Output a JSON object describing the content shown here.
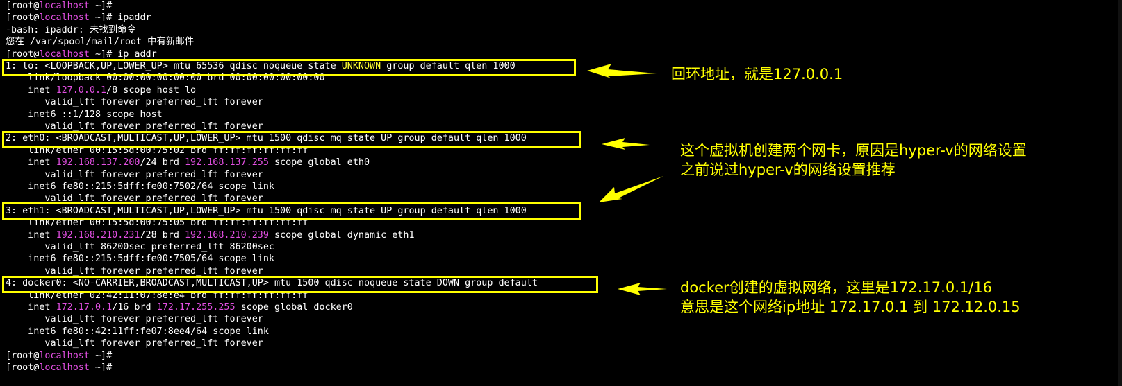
{
  "window": {
    "title": ""
  },
  "terminal": {
    "lines": [
      [
        {
          "t": "[root@"
        },
        {
          "t": "localhost",
          "c": "host"
        },
        {
          "t": " ~]#"
        }
      ],
      [
        {
          "t": "[root@"
        },
        {
          "t": "localhost",
          "c": "host"
        },
        {
          "t": " ~]# ipaddr"
        }
      ],
      [
        {
          "t": "-bash: ipaddr: 未找到命令"
        }
      ],
      [
        {
          "t": "您在 /var/spool/mail/root 中有新邮件"
        }
      ],
      [
        {
          "t": "[root@"
        },
        {
          "t": "localhost",
          "c": "host"
        },
        {
          "t": " ~]# ip addr"
        }
      ],
      [
        {
          "t": "1: lo: <LOOPBACK,UP,LOWER_UP> mtu 65536 qdisc noqueue state "
        },
        {
          "t": "UNKNOWN",
          "c": "state"
        },
        {
          "t": " group default qlen 1000"
        }
      ],
      [
        {
          "t": "    link/loopback 00:00:00:00:00:00 brd 00:00:00:00:00:00"
        }
      ],
      [
        {
          "t": "    inet "
        },
        {
          "t": "127.0.0.1",
          "c": "ip"
        },
        {
          "t": "/8 scope host lo"
        }
      ],
      [
        {
          "t": "       valid_lft forever preferred_lft forever"
        }
      ],
      [
        {
          "t": "    inet6 ::1/128 scope host"
        }
      ],
      [
        {
          "t": "       valid_lft forever preferred_lft forever"
        }
      ],
      [
        {
          "t": "2: eth0: <BROADCAST,MULTICAST,UP,LOWER_UP> mtu 1500 qdisc mq state UP group default qlen 1000"
        }
      ],
      [
        {
          "t": "    link/ether 00:15:5d:00:75:02 brd ff:ff:ff:ff:ff:ff"
        }
      ],
      [
        {
          "t": "    inet "
        },
        {
          "t": "192.168.137.200",
          "c": "ip"
        },
        {
          "t": "/24 brd "
        },
        {
          "t": "192.168.137.255",
          "c": "ip"
        },
        {
          "t": " scope global eth0"
        }
      ],
      [
        {
          "t": "       valid_lft forever preferred_lft forever"
        }
      ],
      [
        {
          "t": "    inet6 fe80::215:5dff:fe00:7502/64 scope link"
        }
      ],
      [
        {
          "t": "       valid_lft forever preferred_lft forever"
        }
      ],
      [
        {
          "t": "3: eth1: <BROADCAST,MULTICAST,UP,LOWER_UP> mtu 1500 qdisc mq state UP group default qlen 1000"
        }
      ],
      [
        {
          "t": "    link/ether 00:15:5d:00:75:05 brd ff:ff:ff:ff:ff:ff"
        }
      ],
      [
        {
          "t": "    inet "
        },
        {
          "t": "192.168.210.231",
          "c": "ip"
        },
        {
          "t": "/28 brd "
        },
        {
          "t": "192.168.210.239",
          "c": "ip"
        },
        {
          "t": " scope global dynamic eth1"
        }
      ],
      [
        {
          "t": "       valid_lft 86200sec preferred_lft 86200sec"
        }
      ],
      [
        {
          "t": "    inet6 fe80::215:5dff:fe00:7505/64 scope link"
        }
      ],
      [
        {
          "t": "       valid_lft forever preferred_lft forever"
        }
      ],
      [
        {
          "t": "4: docker0: <NO-CARRIER,BROADCAST,MULTICAST,UP> mtu 1500 qdisc noqueue state DOWN group default"
        }
      ],
      [
        {
          "t": "    link/ether 02:42:11:07:8e:e4 brd ff:ff:ff:ff:ff:ff"
        }
      ],
      [
        {
          "t": "    inet "
        },
        {
          "t": "172.17.0.1",
          "c": "ip"
        },
        {
          "t": "/16 brd "
        },
        {
          "t": "172.17.255.255",
          "c": "ip"
        },
        {
          "t": " scope global docker0"
        }
      ],
      [
        {
          "t": "       valid_lft forever preferred_lft forever"
        }
      ],
      [
        {
          "t": "    inet6 fe80::42:11ff:fe07:8ee4/64 scope link"
        }
      ],
      [
        {
          "t": "       valid_lft forever preferred_lft forever"
        }
      ],
      [
        {
          "t": "[root@"
        },
        {
          "t": "localhost",
          "c": "host"
        },
        {
          "t": " ~]#"
        }
      ],
      [
        {
          "t": "[root@"
        },
        {
          "t": "localhost",
          "c": "host"
        },
        {
          "t": " ~]#"
        }
      ]
    ]
  },
  "annotations": {
    "lo": {
      "text": "回环地址，就是127.0.0.1"
    },
    "eth": {
      "line1": "这个虚拟机创建两个网卡，原因是hyper-v的网络设置",
      "line2": "之前说过hyper-v的网络设置推荐"
    },
    "docker": {
      "line1": "docker创建的虚拟网络，这里是172.17.0.1/16",
      "line2": "意思是这个网络ip地址 172.17.0.1 到 172.12.0.15"
    }
  },
  "colors": {
    "background": "#000000",
    "text": "#ffffff",
    "hostname": "#e24fe2",
    "ip_address": "#e24fe2",
    "unknown_state": "#ffff33",
    "annotation": "#ffff00"
  }
}
